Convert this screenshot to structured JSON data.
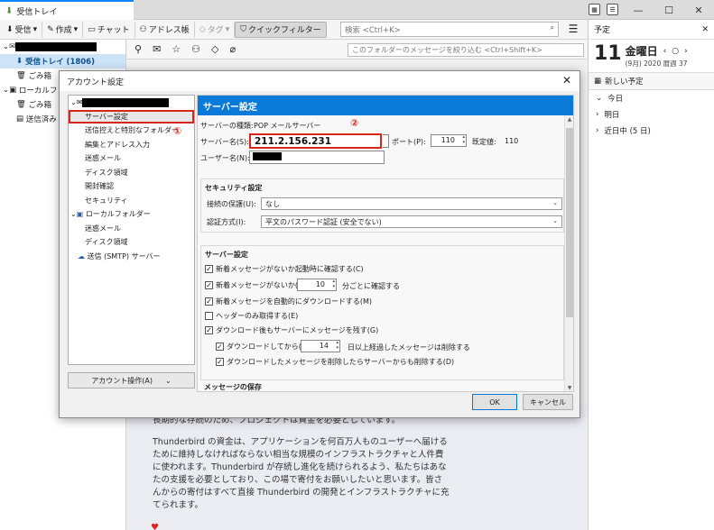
{
  "tab": {
    "label": "受信トレイ"
  },
  "toolbar": {
    "get": "受信",
    "write": "作成",
    "chat": "チャット",
    "addressbook": "アドレス帳",
    "tag": "タグ",
    "quickfilter": "クイックフィルター",
    "search_placeholder": "検索 <Ctrl+K>",
    "filter_placeholder": "このフォルダーのメッセージを絞り込む <Ctrl+Shift+K>"
  },
  "folders": {
    "inbox": "受信トレイ (1806)",
    "trash1": "ごみ箱",
    "local": "ローカルフォ",
    "trash2": "ごみ箱",
    "sent": "送信済みト"
  },
  "message": {
    "p1": "長期的な存続のため、プロジェクトは資金を必要としています。",
    "p2": "Thunderbird の資金は、アプリケーションを何百万人ものユーザーへ届けるために維持しなければならない相当な規模のインフラストラクチャと人件費に使われます。Thunderbird が存続し進化を続けられるよう、私たちはあなたの支援を必要としており、この場で寄付をお願いしたいと思います。皆さんからの寄付はすべて直接 Thunderbird の開発とインフラストラクチャに充てられます。"
  },
  "agenda": {
    "title": "予定",
    "day": "11",
    "weekday": "金曜日",
    "sub": "(9月) 2020 暦週 37",
    "new_event": "新しい予定",
    "today": "今日",
    "tomorrow": "明日",
    "upcoming": "近日中 (5 日)"
  },
  "dialog": {
    "title": "アカウント設定",
    "tree": {
      "server_settings": "サーバー設定",
      "copies": "送信控えと特別なフォルダー",
      "composition": "編集とアドレス入力",
      "junk": "迷惑メール",
      "disk": "ディスク領域",
      "receipts": "開封確認",
      "security": "セキュリティ",
      "local_folders": "ローカルフォルダー",
      "local_junk": "迷惑メール",
      "local_disk": "ディスク領域",
      "smtp": "送信 (SMTP) サーバー"
    },
    "account_actions": "アカウント操作(A)",
    "panel_title": "サーバー設定",
    "server_type_label": "サーバーの種類:",
    "server_type_value": "POP メールサーバー",
    "server_name_label": "サーバー名(S):",
    "server_name_value": "211.2.156.231",
    "port_label": "ポート(P):",
    "port_value": "110",
    "default_label": "既定値:",
    "default_value": "110",
    "username_label": "ユーザー名(N):",
    "security_title": "セキュリティ設定",
    "conn_security_label": "接続の保護(U):",
    "conn_security_value": "なし",
    "auth_label": "認証方式(I):",
    "auth_value": "平文のパスワード認証 (安全でない)",
    "server_group_title": "サーバー設定",
    "check_startup": "新着メッセージがないか起動時に確認する(C)",
    "check_every": "新着メッセージがないか(Y)",
    "check_every_value": "10",
    "check_every_suffix": "分ごとに確認する",
    "auto_download": "新着メッセージを自動的にダウンロードする(M)",
    "headers_only": "ヘッダーのみ取得する(E)",
    "leave_on_server": "ダウンロード後もサーバーにメッセージを残す(G)",
    "for_at_most": "ダウンロードしてから(O)",
    "days_value": "14",
    "days_suffix": "日以上経過したメッセージは削除する",
    "delete_from_server": "ダウンロードしたメッセージを削除したらサーバーからも削除する(D)",
    "message_storage": "メッセージの保存",
    "ok": "OK",
    "cancel": "キャンセル"
  },
  "annotations": {
    "m1": "①",
    "m2": "②"
  }
}
